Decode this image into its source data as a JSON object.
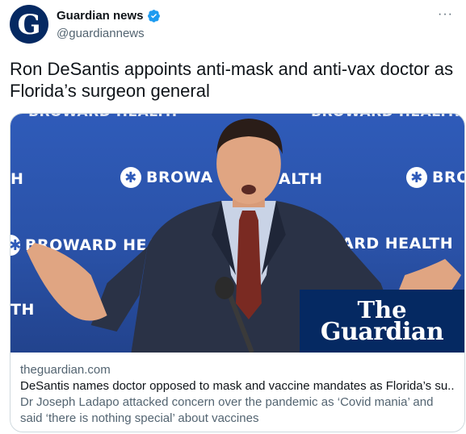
{
  "account": {
    "display_name": "Guardian news",
    "handle": "@guardiannews",
    "avatar_letter": "G",
    "verified": true
  },
  "more_menu": "···",
  "tweet": {
    "text": "Ron DeSantis appoints anti-mask and anti-vax doctor as Florida’s surgeon general"
  },
  "card": {
    "image": {
      "backdrop_text": [
        "BROWARD HEALTH",
        "BROWARD HEALTH",
        "H",
        "BROWA",
        "ALTH",
        "BRO",
        "BROWARD HEA",
        "ARD HEALTH",
        "TH"
      ],
      "logo_lines": [
        "The",
        "Guardian"
      ]
    },
    "domain": "theguardian.com",
    "title": "DeSantis names doctor opposed to mask and vaccine mandates as Florida’s su...",
    "description": "Dr Joseph Ladapo attacked concern over the pandemic as ‘Covid mania’ and said ‘there is nothing special’ about vaccines"
  },
  "colors": {
    "guardian_navy": "#052962",
    "backdrop_blue": "#2f5bb9",
    "verified_blue": "#1d9bf0",
    "text_primary": "#0f1419",
    "text_secondary": "#536471"
  }
}
